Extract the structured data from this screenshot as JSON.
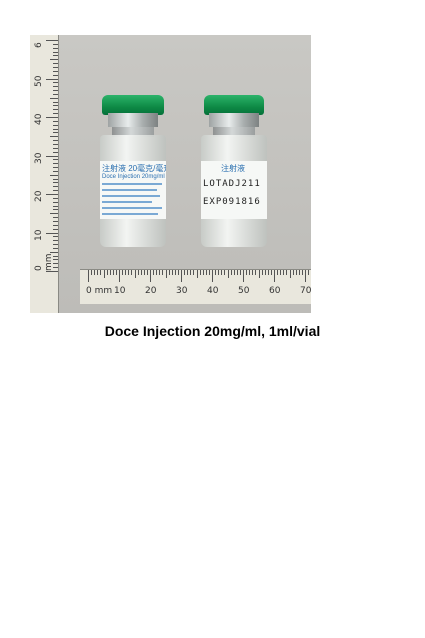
{
  "photo": {
    "description_icon": "vial-photo",
    "ruler_vertical_labels": [
      "0 mm",
      "10",
      "20",
      "30",
      "40",
      "50",
      "6"
    ],
    "ruler_horizontal_labels": [
      "0 mm",
      "10",
      "20",
      "30",
      "40",
      "50",
      "60",
      "70"
    ],
    "left_vial_label": {
      "title": "注射液 20毫克/毫升",
      "subtitle": "Doce Injection 20mg/ml"
    },
    "right_vial_label": {
      "title": "注射液",
      "lot": "LOTADJ211",
      "exp": "EXP091816"
    },
    "cap_color": "#15994f"
  },
  "caption": "Doce Injection 20mg/ml, 1ml/vial"
}
